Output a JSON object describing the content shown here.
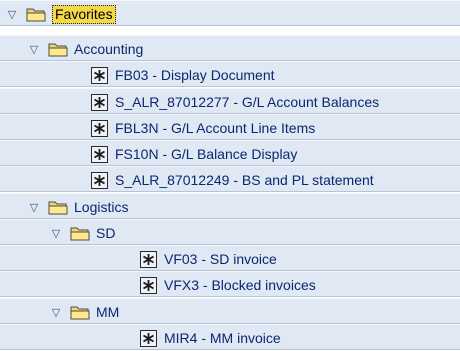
{
  "tree": {
    "root": {
      "label": "Favorites",
      "expanded_icon": "triangle-down-icon",
      "folder_icon": "folder-icon"
    },
    "accounting": {
      "label": "Accounting",
      "items": [
        {
          "label": "FB03 - Display Document"
        },
        {
          "label": "S_ALR_87012277 - G/L Account Balances"
        },
        {
          "label": "FBL3N - G/L Account Line Items"
        },
        {
          "label": "FS10N - G/L Balance Display"
        },
        {
          "label": "S_ALR_87012249 - BS and PL statement"
        }
      ]
    },
    "logistics": {
      "label": "Logistics",
      "sd": {
        "label": "SD",
        "items": [
          {
            "label": "VF03 - SD invoice"
          },
          {
            "label": "VFX3 - Blocked invoices"
          }
        ]
      },
      "mm": {
        "label": "MM",
        "items": [
          {
            "label": "MIR4 - MM invoice"
          }
        ]
      }
    }
  },
  "colors": {
    "row_background": "#dfe8f3",
    "text": "#0a2870",
    "favorites_highlight": "#f3d84a",
    "folder_fill": "#f1d670",
    "transaction_icon": "#eef2f8"
  }
}
